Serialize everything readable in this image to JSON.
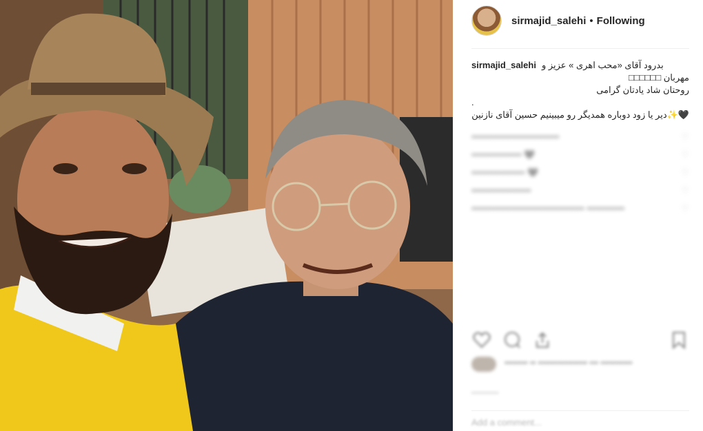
{
  "post": {
    "username": "sirmajid_salehi",
    "separator": "•",
    "follow_status": "Following",
    "caption_lines": [
      "بدرود آقای «محب اهری » عزیز و",
      "مهربان □□□□□□",
      "روحتان شاد یادتان گرامی",
      ".",
      "🖤✨دیر یا زود دوباره همدیگر رو میبینیم حسین آقای نازنین"
    ]
  },
  "comments": [
    {
      "user": "",
      "text": "••••••••••••••••••••••••••••"
    },
    {
      "user": "",
      "text": "•••••••••••••••• 🖤"
    },
    {
      "user": "",
      "text": "••••••••••••••••• 🖤"
    },
    {
      "user": "",
      "text": "•••••••••••••••••••"
    },
    {
      "user": "",
      "text": "•••••••••••••••••••••••••••••••••••• ••••••••••••"
    }
  ],
  "actions": {
    "like_icon": "heart-icon",
    "comment_icon": "comment-icon",
    "share_icon": "share-icon",
    "save_icon": "bookmark-icon"
  },
  "likes_text": "•••••••• •• ••••••••••••••••• ••• •••••••••••",
  "timestamp": "••••••••••",
  "add_comment_placeholder": "Add a comment..."
}
